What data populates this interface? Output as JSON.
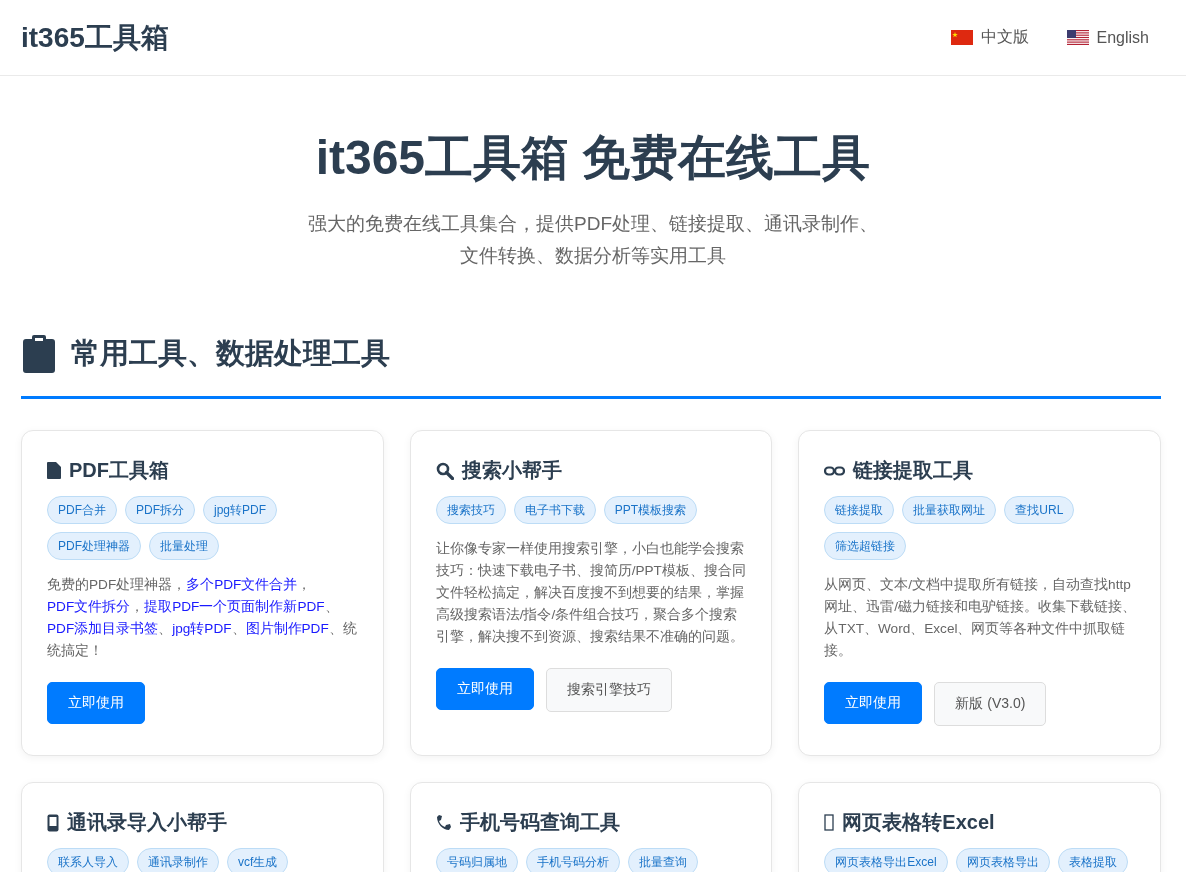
{
  "header": {
    "logo": "it365工具箱",
    "languages": [
      {
        "kind": "cn",
        "label": "中文版"
      },
      {
        "kind": "us",
        "label": "English"
      }
    ]
  },
  "hero": {
    "title": "it365工具箱 免费在线工具",
    "subtitle_lines": [
      "强大的免费在线工具集合，提供PDF处理、链接提取、通讯录制作、",
      "文件转换、数据分析等实用工具"
    ]
  },
  "section": {
    "title": "常用工具、数据处理工具"
  },
  "cards": [
    {
      "kind": "document",
      "title": "PDF工具箱",
      "tags": [
        "PDF合并",
        "PDF拆分",
        "jpg转PDF",
        "PDF处理神器",
        "批量处理"
      ],
      "description": [
        {
          "text": "免费的PDF处理神器，",
          "link": false
        },
        {
          "text": "多个PDF文件合并",
          "link": true
        },
        {
          "text": "，",
          "link": false
        },
        {
          "text": "PDF文件拆分",
          "link": true
        },
        {
          "text": "，",
          "link": false
        },
        {
          "text": "提取PDF一个页面制作新PDF",
          "link": true
        },
        {
          "text": "、",
          "link": false
        },
        {
          "text": "PDF添加目录书签",
          "link": true
        },
        {
          "text": "、",
          "link": false
        },
        {
          "text": "jpg转PDF",
          "link": true
        },
        {
          "text": "、",
          "link": false
        },
        {
          "text": "图片制作PDF",
          "link": true
        },
        {
          "text": "、统统搞定！",
          "link": false
        }
      ],
      "buttons": [
        {
          "label": "立即使用",
          "kind": "primary"
        }
      ]
    },
    {
      "kind": "search",
      "title": "搜索小帮手",
      "tags": [
        "搜索技巧",
        "电子书下载",
        "PPT模板搜索"
      ],
      "description": [
        {
          "text": "让你像专家一样使用搜索引擎，小白也能学会搜索技巧：快速下载电子书、搜简历/PPT模板、搜合同文件轻松搞定，解决百度搜不到想要的结果，掌握高级搜索语法/指令/条件组合技巧，聚合多个搜索引擎，解决搜不到资源、搜索结果不准确的问题。",
          "link": false
        }
      ],
      "buttons": [
        {
          "label": "立即使用",
          "kind": "primary"
        },
        {
          "label": "搜索引擎技巧",
          "kind": "secondary"
        }
      ]
    },
    {
      "kind": "link",
      "title": "链接提取工具",
      "tags": [
        "链接提取",
        "批量获取网址",
        "查找URL",
        "筛选超链接"
      ],
      "description": [
        {
          "text": "从网页、文本/文档中提取所有链接，自动查找http网址、迅雷/磁力链接和电驴链接。收集下载链接、从TXT、Word、Excel、网页等各种文件中抓取链接。",
          "link": false
        }
      ],
      "buttons": [
        {
          "label": "立即使用",
          "kind": "primary"
        },
        {
          "label": "新版 (V3.0)",
          "kind": "secondary"
        }
      ]
    },
    {
      "kind": "mobile",
      "title": "通讯录导入小帮手",
      "tags": [
        "联系人导入",
        "通讯录制作",
        "vcf生成"
      ]
    },
    {
      "kind": "phone",
      "title": "手机号码查询工具",
      "tags": [
        "号码归属地",
        "手机号码分析",
        "批量查询"
      ]
    },
    {
      "kind": "missing",
      "title": "网页表格转Excel",
      "tags": [
        "网页表格导出Excel",
        "网页表格导出",
        "表格提取"
      ]
    }
  ]
}
